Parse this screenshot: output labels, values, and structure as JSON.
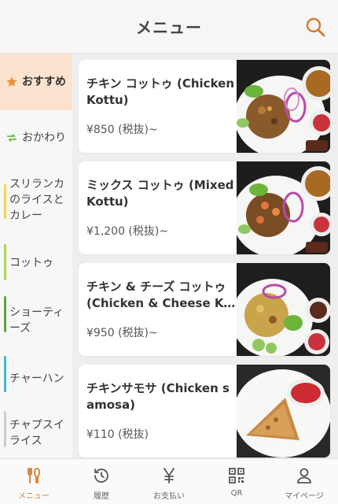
{
  "header": {
    "title": "メニュー"
  },
  "sidebar": {
    "items": [
      {
        "label": "おすすめ",
        "icon": "star-icon"
      },
      {
        "label": "おかわり",
        "icon": "refresh-icon"
      },
      {
        "label": "スリランカのライスとカレー"
      },
      {
        "label": "コットゥ"
      },
      {
        "label": "ショーティーズ"
      },
      {
        "label": "チャーハン"
      },
      {
        "label": "チャプスイライス"
      }
    ]
  },
  "menu": {
    "items": [
      {
        "name": "チキン コットゥ (Chicken Kottu)",
        "price": "¥850 (税抜)~"
      },
      {
        "name": "ミックス コットゥ (Mixed Kottu)",
        "price": "¥1,200 (税抜)~"
      },
      {
        "name": "チキン & チーズ コットゥ (Chicken & Cheese Kottu)",
        "price": "¥950 (税抜)~"
      },
      {
        "name": "チキンサモサ (Chicken samosa)",
        "price": "¥110 (税抜)"
      }
    ]
  },
  "bottom_nav": {
    "items": [
      {
        "label": "メニュー",
        "icon": "fork-knife-icon"
      },
      {
        "label": "履歴",
        "icon": "history-icon"
      },
      {
        "label": "お支払い",
        "icon": "yen-icon"
      },
      {
        "label": "QR",
        "icon": "qr-code-icon"
      },
      {
        "label": "マイページ",
        "icon": "person-icon"
      }
    ]
  },
  "colors": {
    "accent": "#d67a2e",
    "active_category_bg": "#fbe3cf",
    "category_bars": [
      "#f2d64c",
      "#a6d84f",
      "#5aa63a",
      "#49b6d1",
      "#cccccc"
    ]
  }
}
